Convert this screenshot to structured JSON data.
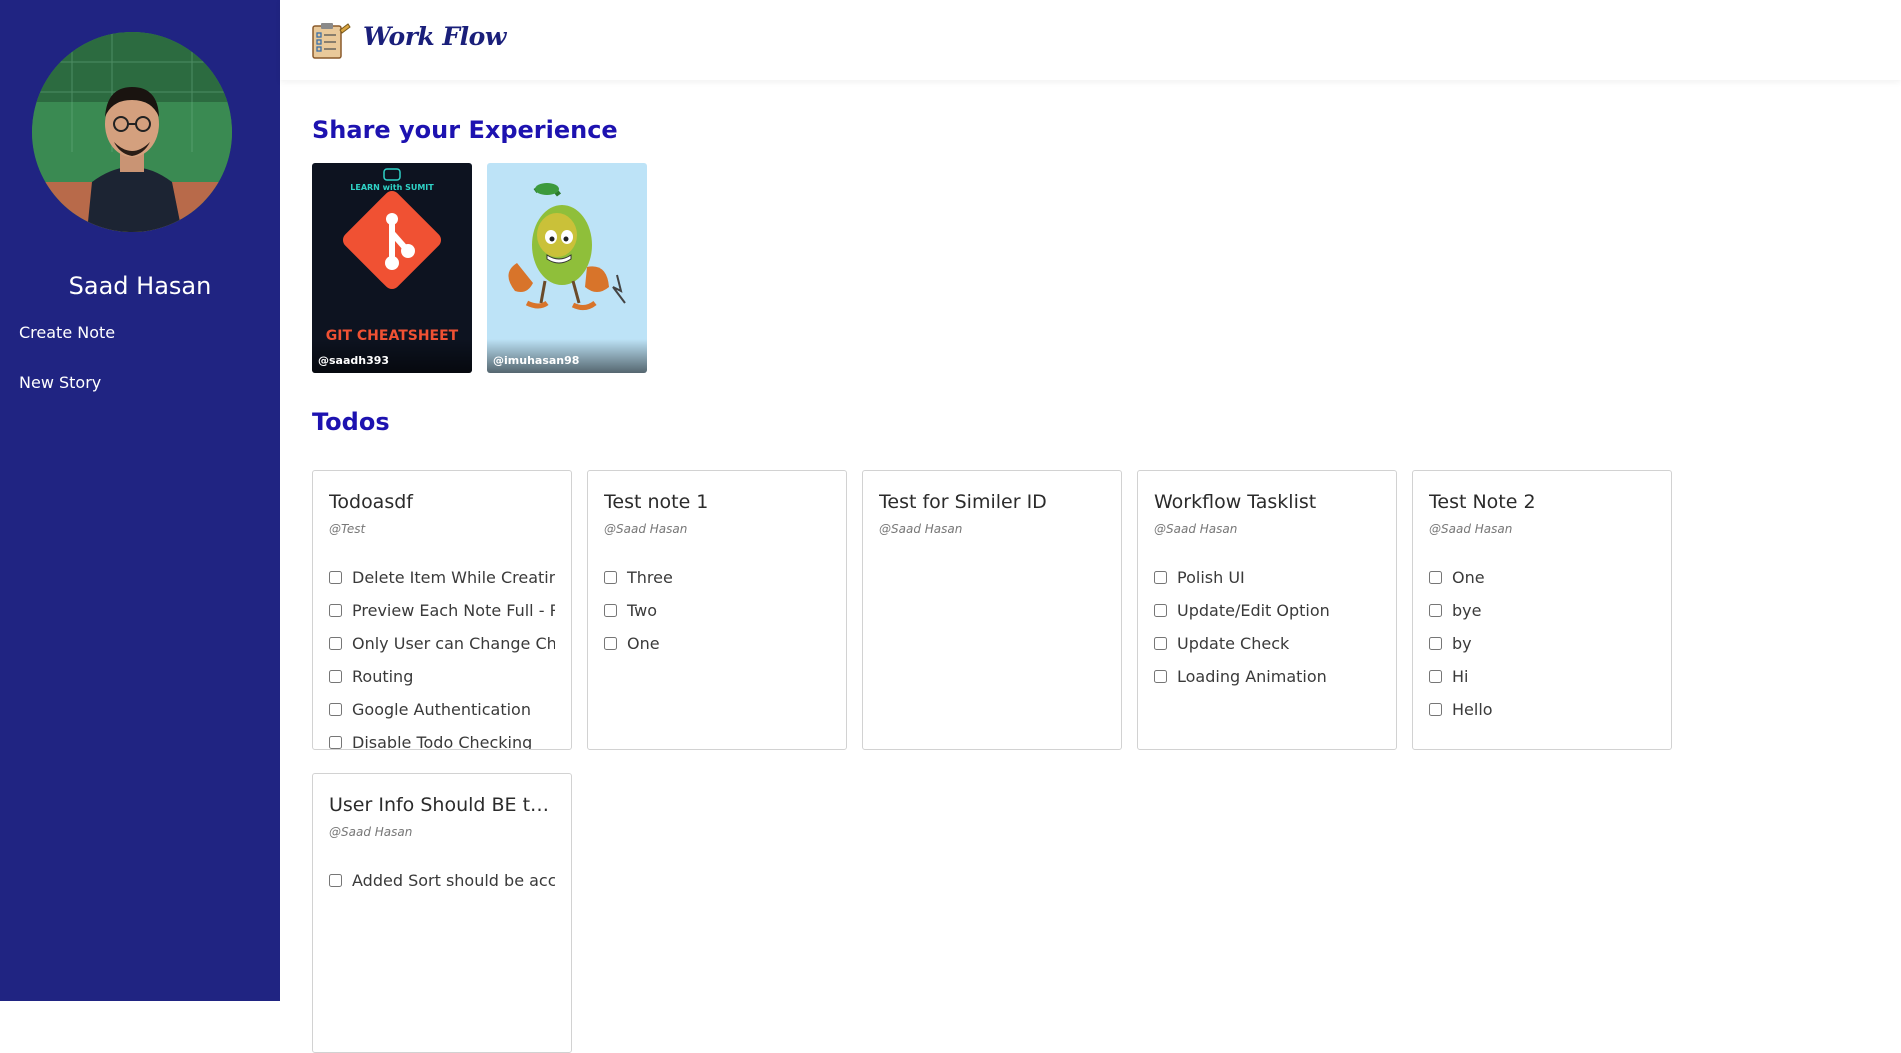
{
  "sidebar": {
    "profile_name": "Saad Hasan",
    "links": [
      "Create Note",
      "New Story"
    ]
  },
  "header": {
    "brand": "Work Flow"
  },
  "stories_section": {
    "title": "Share your Experience",
    "stories": [
      {
        "handle": "@saadh393",
        "caption": "GIT CHEATSHEET",
        "badge": "LEARN with SUMIT"
      },
      {
        "handle": "@imuhasan98"
      }
    ]
  },
  "todos_section": {
    "title": "Todos",
    "notes": [
      {
        "title": "Todoasdf",
        "author": "@Test",
        "items": [
          "Delete Item While Creating",
          "Preview Each Note Full - Read",
          "Only User can Change Checkbox",
          "Routing",
          "Google Authentication",
          "Disable Todo Checking"
        ]
      },
      {
        "title": "Test note 1",
        "author": "@Saad Hasan",
        "items": [
          "Three",
          "Two",
          "One"
        ]
      },
      {
        "title": "Test for Similer ID",
        "author": "@Saad Hasan",
        "items": []
      },
      {
        "title": "Workflow Tasklist",
        "author": "@Saad Hasan",
        "items": [
          "Polish UI",
          "Update/Edit Option",
          "Update Check",
          "Loading Animation"
        ]
      },
      {
        "title": "Test Note 2",
        "author": "@Saad Hasan",
        "items": [
          "One",
          "bye",
          "by",
          "Hi",
          "Hello"
        ]
      },
      {
        "title": "User Info Should BE th...",
        "author": "@Saad Hasan",
        "items": [
          "Added Sort should be according"
        ]
      }
    ]
  },
  "colors": {
    "sidebar_bg": "#202482",
    "heading": "#1d12b0",
    "brand": "#1a1f7a"
  }
}
